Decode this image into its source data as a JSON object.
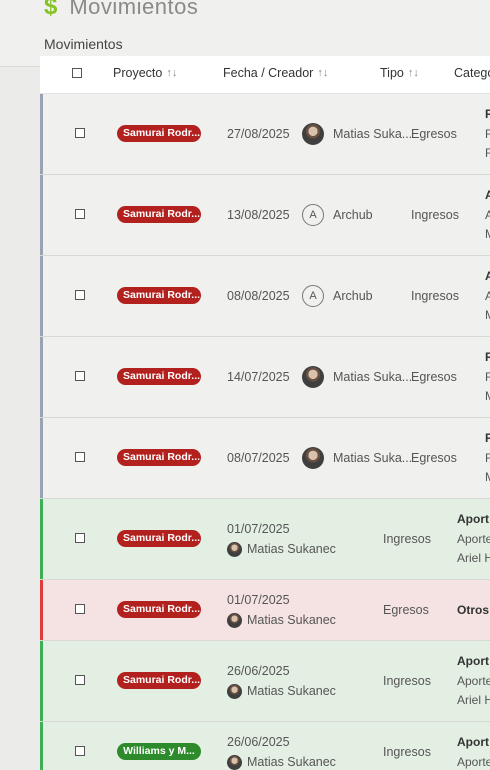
{
  "header": {
    "title": "Movimientos",
    "icon": "dollar-icon"
  },
  "tabs": [
    {
      "label": "Movimientos",
      "active": true
    }
  ],
  "columns": {
    "proyecto": "Proyecto",
    "fecha": "Fecha / Creador",
    "tipo": "Tipo",
    "categoria": "Catego"
  },
  "colors": {
    "accent": "#84c225",
    "badge_red": "#b3211f",
    "badge_green": "#2e8b2c",
    "income_bar": "#3cb054",
    "expense_bar": "#e03c3c",
    "pending_bar": "#9aa3b3"
  },
  "rows": [
    {
      "project": "Samurai Rodr...",
      "date": "27/08/2025",
      "creator": "Matias Suka...",
      "tipo": "Egresos",
      "cat": [
        "R",
        "F",
        "F"
      ]
    },
    {
      "project": "Samurai Rodr...",
      "date": "13/08/2025",
      "creator": "Archub",
      "avatar_letter": "A",
      "tipo": "Ingresos",
      "cat": [
        "A",
        "A",
        "M"
      ]
    },
    {
      "project": "Samurai Rodr...",
      "date": "08/08/2025",
      "creator": "Archub",
      "avatar_letter": "A",
      "tipo": "Ingresos",
      "cat": [
        "A",
        "A",
        "M"
      ]
    },
    {
      "project": "Samurai Rodr...",
      "date": "14/07/2025",
      "creator": "Matias Suka...",
      "tipo": "Egresos",
      "cat": [
        "R",
        "F",
        "M"
      ]
    },
    {
      "project": "Samurai Rodr...",
      "date": "08/07/2025",
      "creator": "Matias Suka...",
      "tipo": "Egresos",
      "cat": [
        "R",
        "F",
        "M"
      ]
    },
    {
      "project": "Samurai Rodr...",
      "date": "01/07/2025",
      "creator": "Matias Sukanec",
      "tipo": "Ingresos",
      "cat": [
        "Aport",
        "Aporte",
        "Ariel H"
      ]
    },
    {
      "project": "Samurai Rodr...",
      "date": "01/07/2025",
      "creator": "Matias Sukanec",
      "tipo": "Egresos",
      "cat": [
        "Otros"
      ]
    },
    {
      "project": "Samurai Rodr...",
      "date": "26/06/2025",
      "creator": "Matias Sukanec",
      "tipo": "Ingresos",
      "cat": [
        "Aport",
        "Aporte",
        "Ariel H"
      ]
    },
    {
      "project": "Williams y M...",
      "date": "26/06/2025",
      "creator": "Matias Sukanec",
      "tipo": "Ingresos",
      "cat": [
        "Aport",
        "Aporte"
      ]
    }
  ]
}
